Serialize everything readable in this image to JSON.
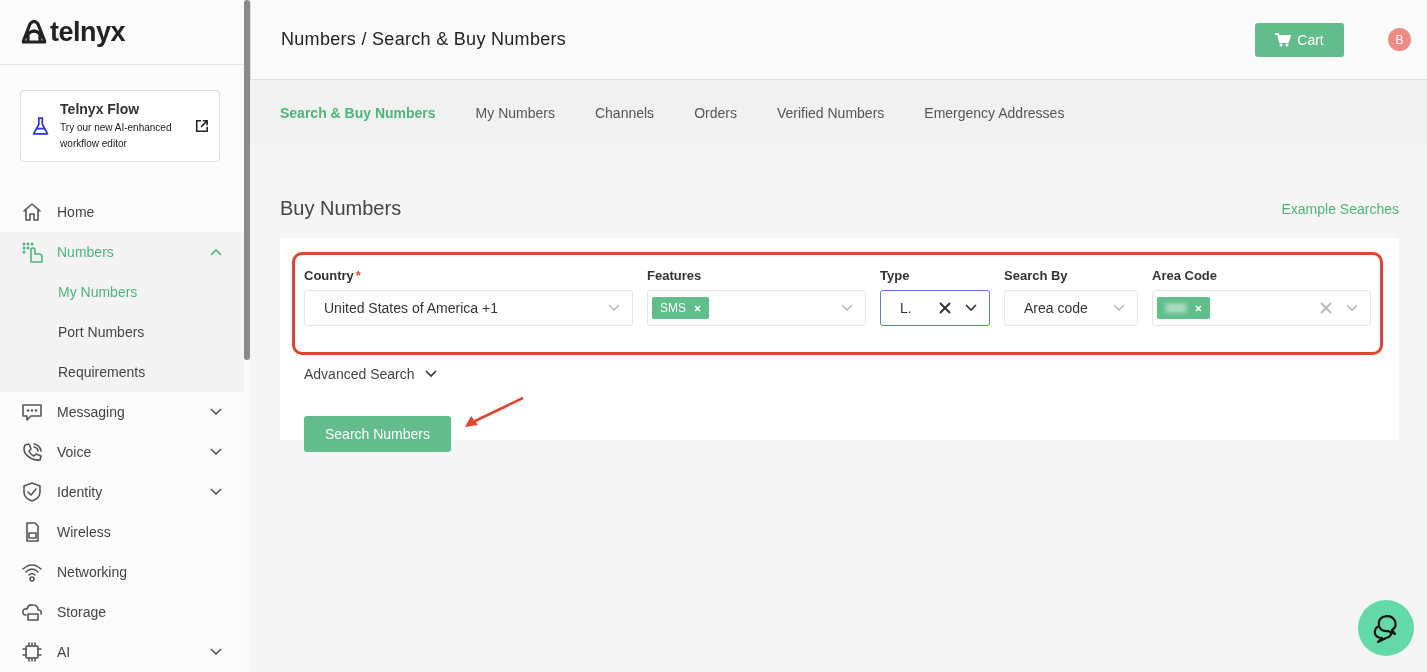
{
  "sidebar": {
    "logo": "telnyx",
    "promo": {
      "title": "Telnyx Flow",
      "text": "Try our new AI-enhanced workflow editor"
    },
    "items": [
      {
        "label": "Home",
        "selected": false
      },
      {
        "label": "Numbers",
        "selected": true,
        "expanded": true,
        "children": [
          {
            "label": "My Numbers",
            "selected": true
          },
          {
            "label": "Port Numbers",
            "selected": false
          },
          {
            "label": "Requirements",
            "selected": false
          }
        ]
      },
      {
        "label": "Messaging",
        "selected": false,
        "expanded": false
      },
      {
        "label": "Voice",
        "selected": false,
        "expanded": false
      },
      {
        "label": "Identity",
        "selected": false,
        "expanded": false
      },
      {
        "label": "Wireless",
        "selected": false
      },
      {
        "label": "Networking",
        "selected": false
      },
      {
        "label": "Storage",
        "selected": false
      },
      {
        "label": "AI",
        "selected": false,
        "expanded": false
      }
    ]
  },
  "header": {
    "breadcrumb": "Numbers / Search & Buy Numbers",
    "cart": "Cart",
    "avatar": "B"
  },
  "tabs": [
    {
      "label": "Search & Buy Numbers",
      "selected": true
    },
    {
      "label": "My Numbers",
      "selected": false
    },
    {
      "label": "Channels",
      "selected": false
    },
    {
      "label": "Orders",
      "selected": false
    },
    {
      "label": "Verified Numbers",
      "selected": false
    },
    {
      "label": "Emergency Addresses",
      "selected": false
    }
  ],
  "page": {
    "title": "Buy Numbers",
    "example_link": "Example Searches"
  },
  "filters": [
    {
      "label": "Country",
      "required_mark": "*",
      "kind": "select",
      "value": "United States of America +1",
      "focused": false
    },
    {
      "label": "Features",
      "kind": "chips",
      "chips": [
        "SMS"
      ],
      "focused": false
    },
    {
      "label": "Type",
      "kind": "select",
      "value": "L.",
      "clearable": true,
      "focused": true
    },
    {
      "label": "Search By",
      "kind": "select",
      "value": "Area code",
      "focused": false
    },
    {
      "label": "Area Code",
      "kind": "redacted",
      "clearable": true,
      "focused": false
    }
  ],
  "advanced_search": "Advanced Search",
  "search_button": "Search Numbers"
}
